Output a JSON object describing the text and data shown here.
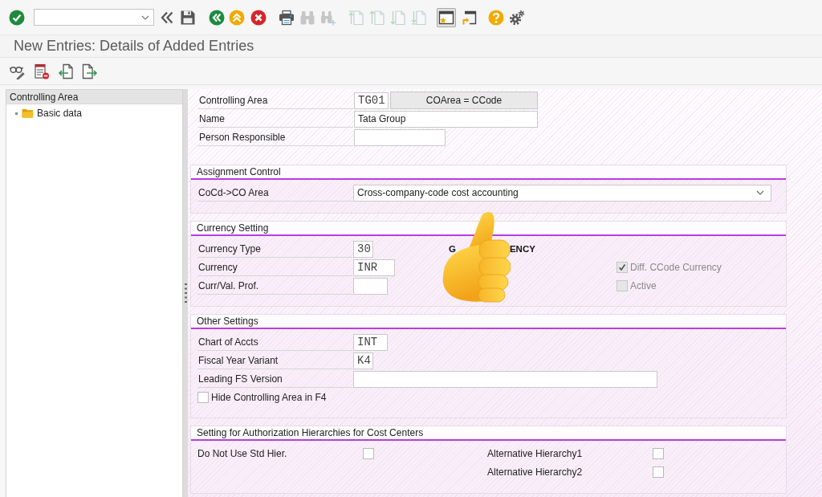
{
  "toolbar": {
    "buttons": [
      {
        "disabled": false,
        "pressed": false
      },
      {
        "disabled": false,
        "pressed": false
      },
      {
        "disabled": false,
        "pressed": false
      },
      {
        "disabled": false,
        "pressed": false
      },
      {
        "disabled": false,
        "pressed": false
      },
      {
        "disabled": false,
        "pressed": false
      },
      {
        "disabled": false,
        "pressed": false
      },
      {
        "disabled": true,
        "pressed": false
      },
      {
        "disabled": true,
        "pressed": false
      },
      {
        "disabled": true,
        "pressed": false
      },
      {
        "disabled": true,
        "pressed": false
      },
      {
        "disabled": true,
        "pressed": false
      },
      {
        "disabled": true,
        "pressed": false
      },
      {
        "disabled": false,
        "pressed": true
      },
      {
        "disabled": false,
        "pressed": false
      },
      {
        "disabled": false,
        "pressed": false
      },
      {
        "disabled": false,
        "pressed": false
      }
    ]
  },
  "title": "New Entries: Details of Added Entries",
  "tree": {
    "header": "Controlling Area",
    "items": [
      {
        "label": "Basic data",
        "selected": false
      }
    ]
  },
  "header_fields": [
    {
      "kind": "code",
      "label": "Controlling Area",
      "value": "TG01",
      "button": "COArea = CCode"
    },
    {
      "kind": "text",
      "label": "Name",
      "value": "Tata Group"
    },
    {
      "kind": "text",
      "label": "Person Responsible"
    }
  ],
  "sections": [
    {
      "title": "Assignment Control",
      "rows": [
        {
          "kind": "select",
          "label": "CoCd->CO Area",
          "value": "Cross-company-code cost accounting"
        }
      ]
    },
    {
      "title": "Currency Setting",
      "rows": [
        {
          "kind": "code",
          "label": "Currency Type",
          "value": "30"
        },
        {
          "kind": "code",
          "label": "Currency",
          "value": "INR"
        },
        {
          "kind": "code",
          "label": "Curr/Val. Prof."
        }
      ],
      "caption_parts": [
        "G",
        "ENCY"
      ],
      "checkboxes": [
        {
          "label": "Diff. CCode Currency",
          "checked": true,
          "disabled": true
        },
        {
          "label": "Active",
          "checked": false,
          "disabled": true
        }
      ]
    },
    {
      "title": "Other Settings",
      "rows": [
        {
          "kind": "code",
          "label": "Chart of Accts",
          "value": "INT"
        },
        {
          "kind": "code",
          "label": "Fiscal Year Variant",
          "value": "K4"
        },
        {
          "kind": "text",
          "label": "Leading FS Version"
        },
        {
          "kind": "check",
          "label": "Hide Controlling Area in F4",
          "checked": false
        }
      ]
    },
    {
      "title": "Setting for Authorization Hierarchies for Cost Centers",
      "columns": [
        [
          {
            "label": "Do Not Use Std Hier.",
            "checked": false
          }
        ],
        [
          {
            "label": "Alternative Hierarchy1",
            "checked": false
          },
          {
            "label": "Alternative Hierarchy2",
            "checked": false
          }
        ]
      ]
    }
  ]
}
